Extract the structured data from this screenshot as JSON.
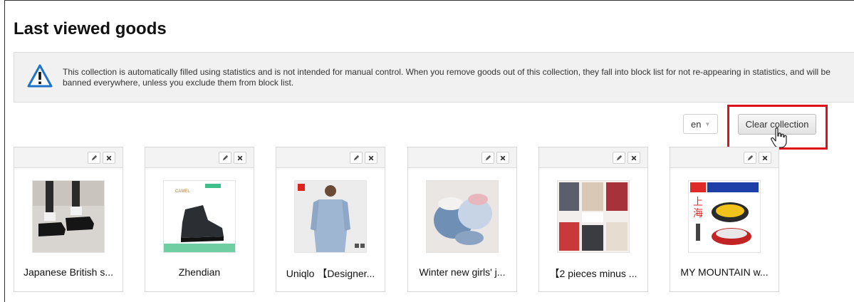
{
  "page": {
    "title": "Last viewed goods"
  },
  "notice": {
    "icon": "warning-icon",
    "text": "This collection is automatically filled using statistics and is not intended for manual control. When you remove goods out of this collection, they fall into block list for not re-appearing in statistics, and will be banned everywhere, unless you exclude them from block list."
  },
  "toolbar": {
    "language": "en",
    "clear_label": "Clear collection"
  },
  "accent_colors": {
    "highlight": "#e0101a",
    "warning": "#1e73c8"
  },
  "items": [
    {
      "caption": "Japanese British s...",
      "icon": "shoes-photo"
    },
    {
      "caption": "Zhendian",
      "icon": "boot-photo"
    },
    {
      "caption": "Uniqlo 【Designer...",
      "icon": "shirt-photo"
    },
    {
      "caption": "Winter new girls' j...",
      "icon": "jacket-photo"
    },
    {
      "caption": "【2 pieces minus ...",
      "icon": "clothing-collage-photo"
    },
    {
      "caption": "MY MOUNTAIN w...",
      "icon": "balance-pad-photo"
    }
  ]
}
